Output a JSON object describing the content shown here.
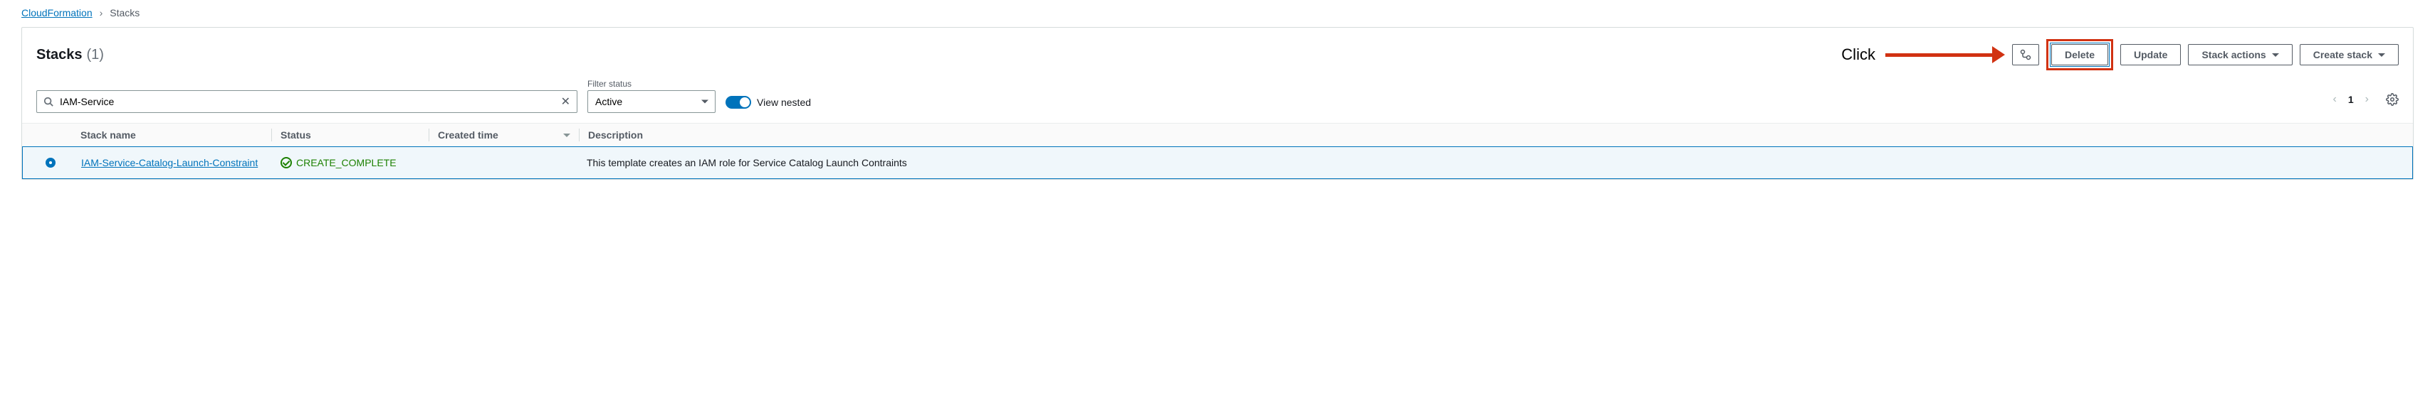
{
  "breadcrumb": {
    "root": "CloudFormation",
    "current": "Stacks"
  },
  "header": {
    "title": "Stacks",
    "count": "(1)"
  },
  "annotation": {
    "label": "Click"
  },
  "buttons": {
    "diff": "",
    "delete": "Delete",
    "update": "Update",
    "stack_actions": "Stack actions",
    "create_stack": "Create stack"
  },
  "search": {
    "value": "IAM-Service"
  },
  "filter": {
    "label": "Filter status",
    "value": "Active"
  },
  "toggle": {
    "label": "View nested",
    "on": true
  },
  "pager": {
    "page": "1"
  },
  "columns": {
    "name": "Stack name",
    "status": "Status",
    "created": "Created time",
    "description": "Description"
  },
  "rows": [
    {
      "name": "IAM-Service-Catalog-Launch-Constraint",
      "status": "CREATE_COMPLETE",
      "created": "",
      "description": "This template creates an IAM role for Service Catalog Launch Contraints"
    }
  ]
}
